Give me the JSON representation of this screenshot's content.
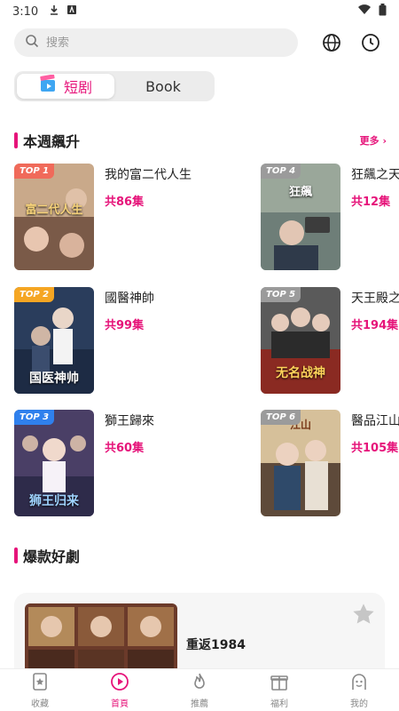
{
  "status": {
    "time": "3:10",
    "icons": [
      "download-icon",
      "notification-a-icon",
      "wifi-icon",
      "battery-icon"
    ]
  },
  "search": {
    "placeholder": "搜索",
    "icon": "search-icon"
  },
  "header_icons": [
    "globe-icon",
    "clock-icon"
  ],
  "tabs": [
    {
      "label": "短剧",
      "active": true,
      "icon": "clapperboard-icon"
    },
    {
      "label": "Book",
      "active": false
    }
  ],
  "rising": {
    "title": "本週飆升",
    "more": "更多 ›",
    "items": [
      {
        "badge": "TOP 1",
        "title": "我的富二代人生",
        "episodes": "共86集",
        "caption": "富二代人生",
        "badge_color": "#f06a5a"
      },
      {
        "badge": "TOP 2",
        "title": "國醫神帥",
        "episodes": "共99集",
        "caption": "国医神帅",
        "badge_color": "#f5a623"
      },
      {
        "badge": "TOP 3",
        "title": "獅王歸來",
        "episodes": "共60集",
        "caption": "狮王归来",
        "badge_color": "#2f80ed"
      },
      {
        "badge": "TOP 4",
        "title": "狂飆之天",
        "episodes": "共12集",
        "caption": "狂飆",
        "badge_color": "#9b9b9b"
      },
      {
        "badge": "TOP 5",
        "title": "天王殿之",
        "episodes": "共194集",
        "caption": "无名战神",
        "badge_color": "#9b9b9b"
      },
      {
        "badge": "TOP 6",
        "title": "醫品江山",
        "episodes": "共105集",
        "caption": "江山",
        "badge_color": "#9b9b9b"
      }
    ]
  },
  "hot": {
    "title": "爆款好劇",
    "card_title": "重返1984",
    "star_icon": "star-icon"
  },
  "nav": [
    {
      "label": "收藏",
      "icon": "bookmark-star-icon",
      "active": false
    },
    {
      "label": "首頁",
      "icon": "play-circle-icon",
      "active": true
    },
    {
      "label": "推薦",
      "icon": "flame-icon",
      "active": false
    },
    {
      "label": "福利",
      "icon": "gift-box-icon",
      "active": false
    },
    {
      "label": "我的",
      "icon": "profile-face-icon",
      "active": false
    }
  ]
}
